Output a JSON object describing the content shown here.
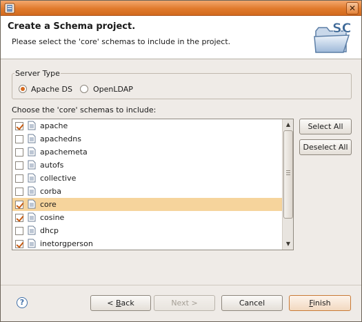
{
  "window": {
    "close_glyph": "✕",
    "icon": "eclipse-app-icon"
  },
  "header": {
    "title": "Create a Schema project.",
    "description": "Please select the 'core' schemas to include in the project.",
    "banner_text": "SC",
    "banner_icon": "folder-icon"
  },
  "server_type": {
    "label": "Server Type",
    "options": [
      {
        "label": "Apache DS",
        "selected": true
      },
      {
        "label": "OpenLDAP",
        "selected": false
      }
    ]
  },
  "schemas": {
    "label": "Choose the 'core' schemas to include:",
    "items": [
      {
        "name": "apache",
        "checked": true,
        "selected": false
      },
      {
        "name": "apachedns",
        "checked": false,
        "selected": false
      },
      {
        "name": "apachemeta",
        "checked": false,
        "selected": false
      },
      {
        "name": "autofs",
        "checked": false,
        "selected": false
      },
      {
        "name": "collective",
        "checked": false,
        "selected": false
      },
      {
        "name": "corba",
        "checked": false,
        "selected": false
      },
      {
        "name": "core",
        "checked": true,
        "selected": true
      },
      {
        "name": "cosine",
        "checked": true,
        "selected": false
      },
      {
        "name": "dhcp",
        "checked": false,
        "selected": false
      },
      {
        "name": "inetorgperson",
        "checked": true,
        "selected": false
      }
    ],
    "select_all": "Select All",
    "deselect_all": "Deselect All"
  },
  "footer": {
    "help_glyph": "?",
    "back_prefix": "< ",
    "back_mnemonic": "B",
    "back_rest": "ack",
    "next": "Next >",
    "cancel": "Cancel",
    "finish_mnemonic": "F",
    "finish_rest": "inish"
  },
  "colors": {
    "accent": "#e07a2c",
    "selection": "#f6d49c",
    "check": "#c85d14"
  }
}
